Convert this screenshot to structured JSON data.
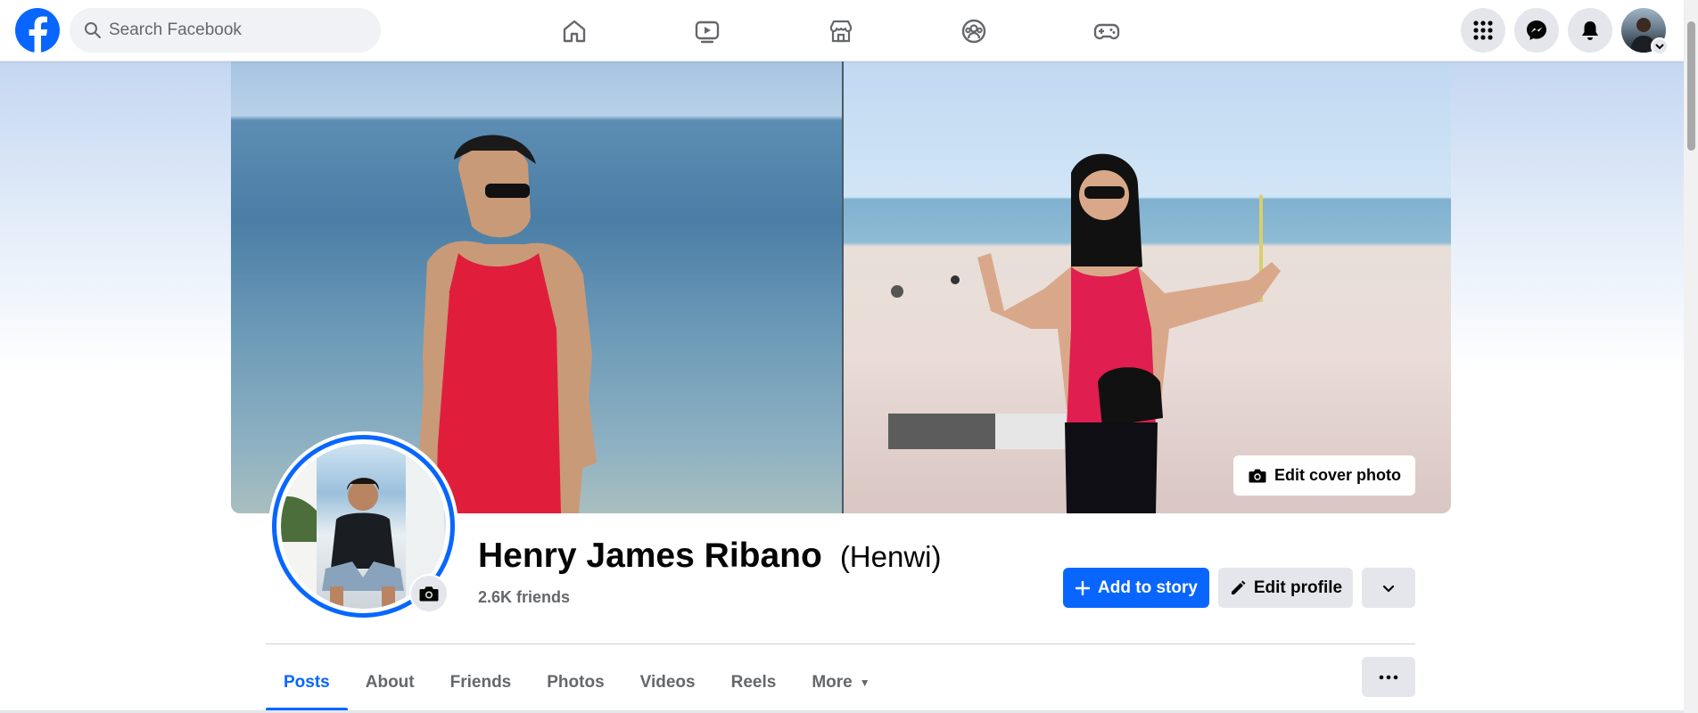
{
  "topbar": {
    "logo_icon": "facebook-logo-icon",
    "search_placeholder": "Search Facebook",
    "nav": [
      "home-icon",
      "video-icon",
      "marketplace-icon",
      "groups-icon",
      "gaming-icon"
    ],
    "right": [
      "menu-grid-icon",
      "messenger-icon",
      "notifications-bell-icon",
      "account-avatar"
    ]
  },
  "cover": {
    "edit_label": "Edit cover photo"
  },
  "profile": {
    "name": "Henry James Ribano",
    "nickname": "(Henwi)",
    "friends": "2.6K friends"
  },
  "actions": {
    "add_story": "Add to story",
    "edit_profile": "Edit profile"
  },
  "tabs": [
    {
      "label": "Posts",
      "active": true
    },
    {
      "label": "About"
    },
    {
      "label": "Friends"
    },
    {
      "label": "Photos"
    },
    {
      "label": "Videos"
    },
    {
      "label": "Reels"
    },
    {
      "label": "More"
    }
  ],
  "colors": {
    "accent": "#0866ff",
    "secondary_button": "#e4e6eb",
    "muted_text": "#65676b"
  }
}
